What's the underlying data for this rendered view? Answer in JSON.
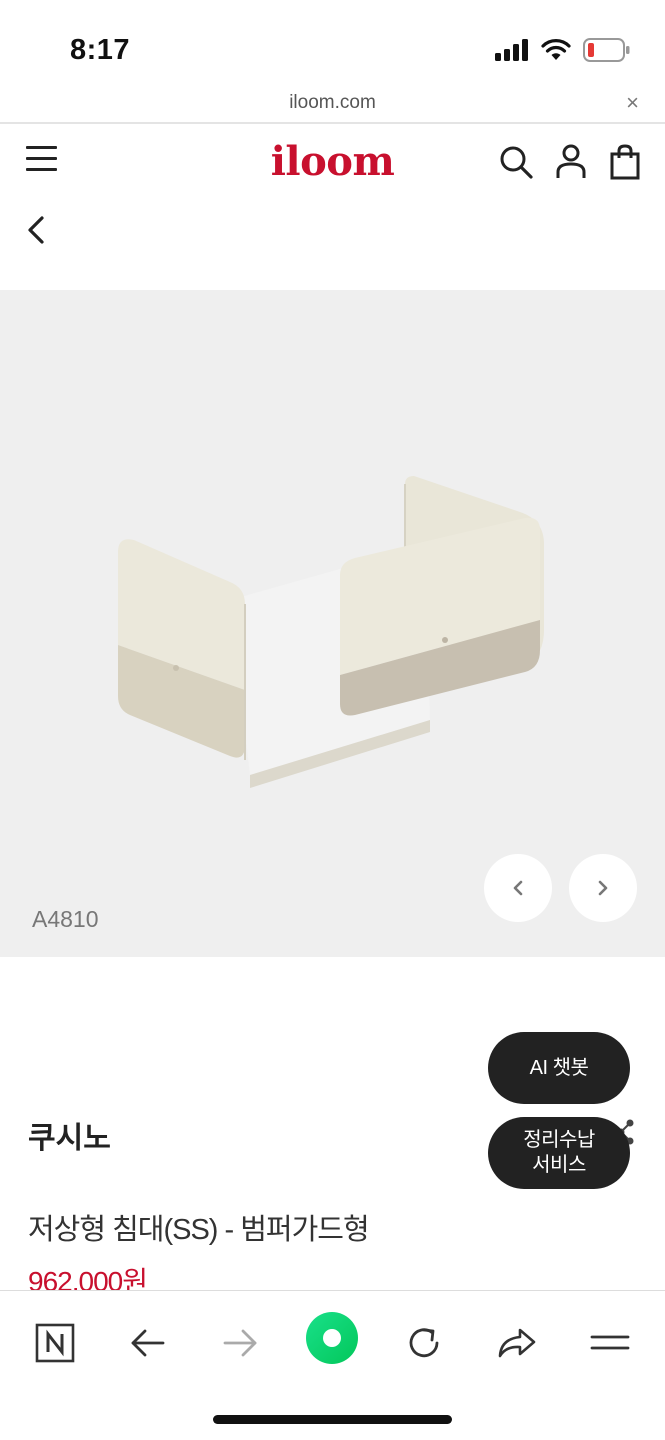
{
  "status": {
    "time": "8:17"
  },
  "browser": {
    "url": "iloom.com",
    "close": "×"
  },
  "header": {
    "logo": "iloom"
  },
  "gallery": {
    "product_code": "A4810"
  },
  "product": {
    "brand": "쿠시노",
    "name": "저상형 침대(SS) - 범퍼가드형",
    "price": "962,000원"
  },
  "floating": {
    "ai_chatbot": "AI 챗봇",
    "org_service_line1": "정리수납",
    "org_service_line2": "서비스"
  },
  "colors": {
    "brand_red": "#c8102e",
    "gallery_bg": "#efefef",
    "pill_bg": "#222222",
    "naver_green": "#03c75a"
  }
}
